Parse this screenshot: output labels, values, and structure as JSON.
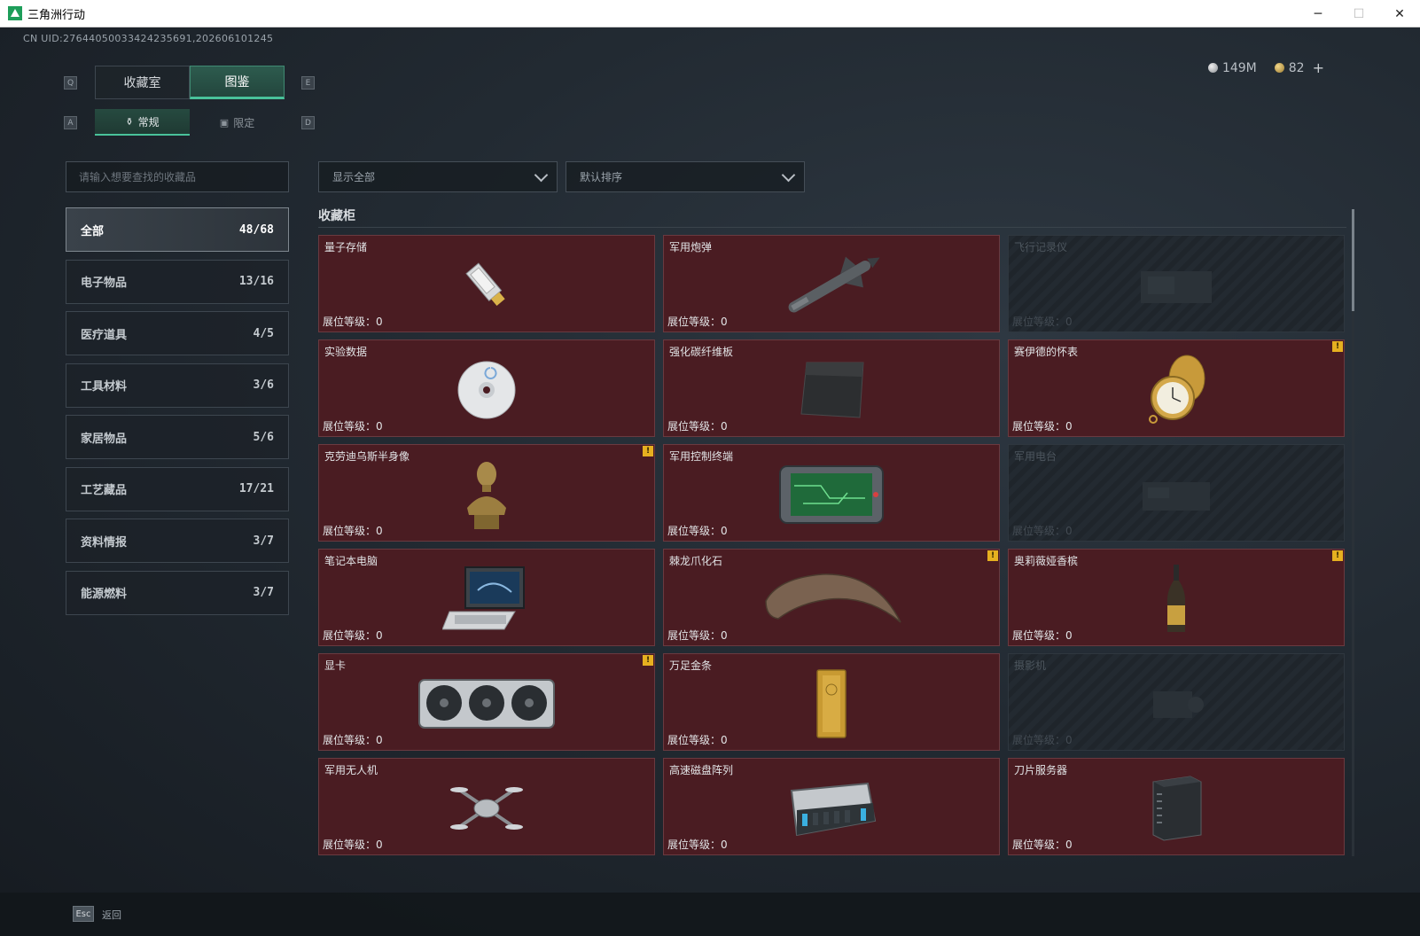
{
  "window": {
    "title": "三角洲行动",
    "minimize": "─",
    "maximize": "☐",
    "close": "✕"
  },
  "uid": "CN UID:27644050033424235691,202606101245",
  "currency": {
    "silver": "149M",
    "gold": "82",
    "add": "+"
  },
  "keys": {
    "q": "Q",
    "e": "E",
    "a": "A",
    "d": "D"
  },
  "tabs": [
    {
      "label": "收藏室"
    },
    {
      "label": "图鉴"
    }
  ],
  "subtabs": [
    {
      "label": "常规"
    },
    {
      "label": "限定"
    }
  ],
  "search": {
    "placeholder": "请输入想要查找的收藏品"
  },
  "categories": [
    {
      "label": "全部",
      "count": "48/68"
    },
    {
      "label": "电子物品",
      "count": "13/16"
    },
    {
      "label": "医疗道具",
      "count": "4/5"
    },
    {
      "label": "工具材料",
      "count": "3/6"
    },
    {
      "label": "家居物品",
      "count": "5/6"
    },
    {
      "label": "工艺藏品",
      "count": "17/21"
    },
    {
      "label": "资料情报",
      "count": "3/7"
    },
    {
      "label": "能源燃料",
      "count": "3/7"
    }
  ],
  "filters": {
    "show": "显示全部",
    "sort": "默认排序"
  },
  "section_title": "收藏柜",
  "items": [
    {
      "name": "量子存储",
      "level": "展位等级：0",
      "icon": "usb-drive-icon"
    },
    {
      "name": "军用炮弹",
      "level": "展位等级：0",
      "icon": "missile-icon"
    },
    {
      "name": "飞行记录仪",
      "level": "展位等级：0",
      "icon": "flight-recorder-icon"
    },
    {
      "name": "实验数据",
      "level": "展位等级：0",
      "icon": "disc-icon"
    },
    {
      "name": "强化碳纤维板",
      "level": "展位等级：0",
      "icon": "carbon-plate-icon"
    },
    {
      "name": "赛伊德的怀表",
      "level": "展位等级：0",
      "icon": "pocket-watch-icon",
      "badge": "!"
    },
    {
      "name": "克劳迪乌斯半身像",
      "level": "展位等级：0",
      "icon": "bust-icon",
      "badge": "!"
    },
    {
      "name": "军用控制终端",
      "level": "展位等级：0",
      "icon": "control-terminal-icon"
    },
    {
      "name": "军用电台",
      "level": "展位等级：0",
      "icon": "radio-icon"
    },
    {
      "name": "笔记本电脑",
      "level": "展位等级：0",
      "icon": "laptop-icon"
    },
    {
      "name": "棘龙爪化石",
      "level": "展位等级：0",
      "icon": "claw-fossil-icon",
      "badge": "!"
    },
    {
      "name": "奥莉薇娅香槟",
      "level": "展位等级：0",
      "icon": "champagne-icon",
      "badge": "!"
    },
    {
      "name": "显卡",
      "level": "展位等级：0",
      "icon": "gpu-icon",
      "badge": "!"
    },
    {
      "name": "万足金条",
      "level": "展位等级：0",
      "icon": "gold-bar-icon"
    },
    {
      "name": "摄影机",
      "level": "展位等级：0",
      "icon": "camera-icon"
    },
    {
      "name": "军用无人机",
      "level": "展位等级：0",
      "icon": "drone-icon"
    },
    {
      "name": "高速磁盘阵列",
      "level": "展位等级：0",
      "icon": "disk-array-icon"
    },
    {
      "name": "刀片服务器",
      "level": "展位等级：0",
      "icon": "blade-server-icon"
    }
  ],
  "footer": {
    "esc": "Esc",
    "back": "返回"
  }
}
